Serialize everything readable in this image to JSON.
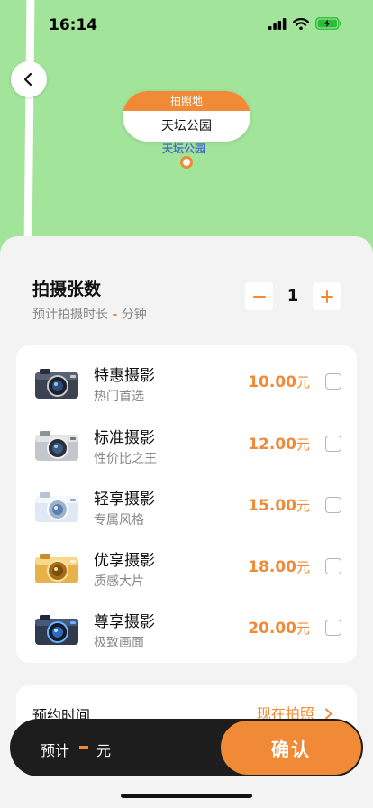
{
  "status": {
    "time": "16:14"
  },
  "map": {
    "location_card": {
      "header": "拍照地",
      "name": "天坛公园"
    },
    "map_label": "天坛公园"
  },
  "count": {
    "title": "拍摄张数",
    "sub_label": "预计拍摄时长",
    "sub_value": "-",
    "sub_unit": "分钟",
    "value": "1",
    "minus_icon": "minus-icon",
    "plus_icon": "plus-icon"
  },
  "packages": [
    {
      "name": "特惠摄影",
      "desc": "热门首选",
      "price": "10.00",
      "unit": "元",
      "icon": "camera-dark-icon",
      "checked": false
    },
    {
      "name": "标准摄影",
      "desc": "性价比之王",
      "price": "12.00",
      "unit": "元",
      "icon": "camera-silver-icon",
      "checked": false
    },
    {
      "name": "轻享摄影",
      "desc": "专属风格",
      "price": "15.00",
      "unit": "元",
      "icon": "camera-white-icon",
      "checked": false
    },
    {
      "name": "优享摄影",
      "desc": "质感大片",
      "price": "18.00",
      "unit": "元",
      "icon": "camera-gold-icon",
      "checked": false
    },
    {
      "name": "尊享摄影",
      "desc": "极致画面",
      "price": "20.00",
      "unit": "元",
      "icon": "camera-blue-icon",
      "checked": false
    }
  ],
  "booking": {
    "label": "预约时间",
    "action": "现在拍照"
  },
  "footer": {
    "total_label": "预计",
    "total_unit": "元",
    "confirm": "确认"
  },
  "colors": {
    "accent": "#f08a36",
    "map": "#a1e49a",
    "bar": "#1d1d1d"
  }
}
